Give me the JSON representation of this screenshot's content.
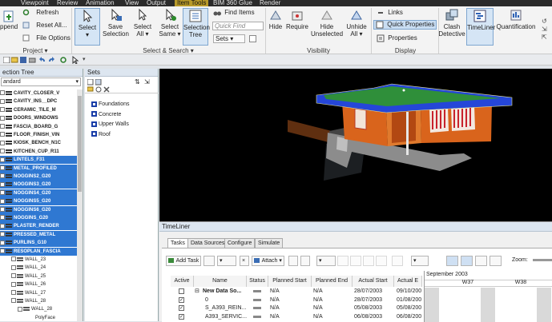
{
  "tabs": [
    "Viewpoint",
    "Review",
    "Animation",
    "View",
    "Output",
    "Item Tools",
    "BIM 360 Glue",
    "Render"
  ],
  "ribbon": {
    "append": "ppend",
    "refresh": "Refresh",
    "reset_all": "Reset All...",
    "file_options": "File Options",
    "project_group": "Project",
    "select": "Select",
    "save_selection": [
      "Save",
      "Selection"
    ],
    "select_all": [
      "Select",
      "All"
    ],
    "select_same": [
      "Select",
      "Same"
    ],
    "selection_tree": [
      "Selection",
      "Tree"
    ],
    "find_items": "Find Items",
    "quick_find_placeholder": "Quick Find",
    "sets": "Sets",
    "select_search_group": "Select & Search",
    "hide": "Hide",
    "require": "Require",
    "hide_unselected": [
      "Hide",
      "Unselected"
    ],
    "unhide_all": [
      "Unhide",
      "All"
    ],
    "visibility_group": "Visibility",
    "links": "Links",
    "quick_properties": "Quick Properties",
    "properties": "Properties",
    "display_group": "Display",
    "clash_detective": [
      "Clash",
      "Detective"
    ],
    "timeliner": "TimeLiner",
    "quantification": "Quantification"
  },
  "selection_tree": {
    "title": "ection Tree",
    "mode": "andard",
    "rows": [
      {
        "label": "CAVITY_CLOSER_V",
        "selected": false
      },
      {
        "label": "CAVITY_INS__DPC",
        "selected": false
      },
      {
        "label": "CERAMIC_TILE_M",
        "selected": false
      },
      {
        "label": "DOORS_WINDOWS",
        "selected": false
      },
      {
        "label": "FASCIA_BOARD_G",
        "selected": false
      },
      {
        "label": "FLOOR_FINISH_VIN",
        "selected": false
      },
      {
        "label": "KIOSK_BENCH_N1C",
        "selected": false
      },
      {
        "label": "KITCHEN_CUP_R11",
        "selected": false
      },
      {
        "label": "LINTELS_F31",
        "selected": true
      },
      {
        "label": "METAL_PROFILED",
        "selected": true
      },
      {
        "label": "NOGGINS2_G20",
        "selected": true
      },
      {
        "label": "NOGGINS3_G20",
        "selected": true
      },
      {
        "label": "NOGGINS4_G20",
        "selected": true
      },
      {
        "label": "NOGGINS5_G20",
        "selected": true
      },
      {
        "label": "NOGGINS6_G20",
        "selected": true
      },
      {
        "label": "NOGGINS_G20",
        "selected": true
      },
      {
        "label": "PLASTER_RENDER",
        "selected": true
      },
      {
        "label": "PRESSED_METAL",
        "selected": true
      },
      {
        "label": "PURLINS_G10",
        "selected": true
      },
      {
        "label": "RESOPLAN_FASCIA",
        "selected": true
      }
    ],
    "walls": [
      "WALL_23",
      "WALL_24",
      "WALL_25",
      "WALL_26",
      "WALL_27",
      "WALL_28",
      "WALL_28"
    ],
    "polyface": "PolyFace"
  },
  "sets": {
    "title": "Sets",
    "items": [
      "Foundations",
      "Concrete",
      "Upper Walls",
      "Roof"
    ]
  },
  "timeliner": {
    "title": "TimeLiner",
    "tabs": [
      "Tasks",
      "Data Sources",
      "Configure",
      "Simulate"
    ],
    "add_task": "Add Task",
    "attach": "Attach",
    "zoom_label": "Zoom:",
    "columns": [
      "Active",
      "Name",
      "Status",
      "Planned Start",
      "Planned End",
      "Actual Start",
      "Actual E"
    ],
    "gantt_month": "September 2003",
    "gantt_weeks": [
      "W37",
      "W38"
    ],
    "rows": [
      {
        "active": false,
        "name": "New Data So...",
        "status": "",
        "planned_start": "N/A",
        "planned_end": "N/A",
        "actual_start": "28/07/2003",
        "actual_end": "09/10/200"
      },
      {
        "active": true,
        "name": "0",
        "status": "",
        "planned_start": "N/A",
        "planned_end": "N/A",
        "actual_start": "28/07/2003",
        "actual_end": "01/08/200"
      },
      {
        "active": true,
        "name": "S_A393_REIN...",
        "status": "",
        "planned_start": "N/A",
        "planned_end": "N/A",
        "actual_start": "05/08/2003",
        "actual_end": "05/08/200"
      },
      {
        "active": true,
        "name": "A393_SERVIC...",
        "status": "",
        "planned_start": "N/A",
        "planned_end": "N/A",
        "actual_start": "06/08/2003",
        "actual_end": "06/08/200"
      }
    ]
  },
  "colors": {
    "selected_row": "#2f78d2",
    "accent_tab": "#b89a2a",
    "roof_blue": "#2546d8",
    "wall_orange": "#d9641c"
  }
}
